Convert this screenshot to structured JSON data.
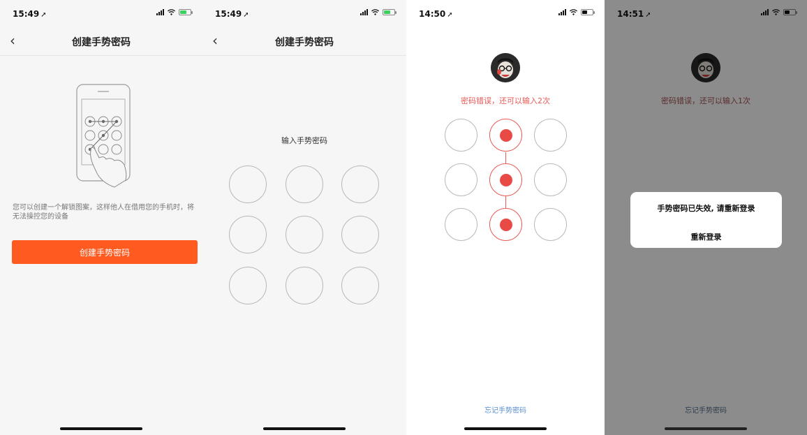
{
  "screens": [
    {
      "status_time": "15:49",
      "nav_title": "创建手势密码",
      "description": "您可以创建一个解锁图案，这样他人在借用您的手机时，将无法操控您的设备",
      "button_label": "创建手势密码"
    },
    {
      "status_time": "15:49",
      "nav_title": "创建手势密码",
      "prompt": "输入手势密码"
    },
    {
      "status_time": "14:50",
      "error_message": "密码错误，还可以输入2次",
      "forgot_link": "忘记手势密码",
      "selected_nodes": [
        2,
        5,
        8
      ]
    },
    {
      "status_time": "14:51",
      "background_error": "密码错误，还可以输入1次",
      "background_forgot": "忘记手势密码",
      "dialog_message": "手势密码已失效, 请重新登录",
      "dialog_action": "重新登录"
    }
  ],
  "icons": {
    "back": "chevron-left-icon",
    "location_arrow": "location-arrow-icon",
    "signal": "signal-icon",
    "wifi": "wifi-icon",
    "battery": "battery-icon"
  },
  "colors": {
    "accent_orange": "#ff5a20",
    "error_red": "#e85a55",
    "link_blue": "#5b8fd1",
    "battery_green": "#3bd15c"
  }
}
